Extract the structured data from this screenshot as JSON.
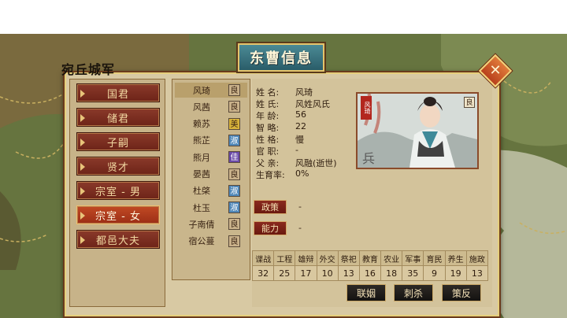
{
  "map_label": "宛丘城军",
  "window_title": "东曹信息",
  "close_icon": "✕",
  "nav": [
    {
      "label": "国君"
    },
    {
      "label": "储君"
    },
    {
      "label": "子嗣"
    },
    {
      "label": "贤才"
    },
    {
      "label": "宗室 - 男"
    },
    {
      "label": "宗室 - 女",
      "selected": true
    },
    {
      "label": "都邑大夫"
    }
  ],
  "people": [
    {
      "name": "风琦",
      "badge": "良",
      "type": "good"
    },
    {
      "name": "风茜",
      "badge": "良",
      "type": "good"
    },
    {
      "name": "赖苏",
      "badge": "美",
      "type": "beauty"
    },
    {
      "name": "熊芷",
      "badge": "淑",
      "type": "gentle"
    },
    {
      "name": "熊月",
      "badge": "佳",
      "type": "fine"
    },
    {
      "name": "晏茜",
      "badge": "良",
      "type": "good"
    },
    {
      "name": "杜棨",
      "badge": "淑",
      "type": "gentle"
    },
    {
      "name": "杜玉",
      "badge": "淑",
      "type": "gentle"
    },
    {
      "name": "子南倩",
      "badge": "良",
      "type": "good"
    },
    {
      "name": "宿公蔓",
      "badge": "良",
      "type": "good"
    }
  ],
  "info": [
    {
      "label": "姓  名:",
      "value": "风琦"
    },
    {
      "label": "姓  氏:",
      "value": "风姓风氏"
    },
    {
      "label": "年  龄:",
      "value": "56"
    },
    {
      "label": "智  略:",
      "value": "22"
    },
    {
      "label": "性  格:",
      "value": "慢"
    },
    {
      "label": "官  职:",
      "value": "-"
    },
    {
      "label": "父  亲:",
      "value": "风融(逝世)"
    },
    {
      "label": "生育率:",
      "value": "0%"
    }
  ],
  "portrait": {
    "tag": "风琦",
    "badge": "良"
  },
  "policy": {
    "label": "政策",
    "value": "-"
  },
  "ability": {
    "label": "能力",
    "value": "-"
  },
  "stats_headers": [
    "谍战",
    "工程",
    "雄辩",
    "外交",
    "祭祀",
    "教育",
    "农业",
    "军事",
    "育民",
    "养生",
    "施政"
  ],
  "stats_values": [
    "32",
    "25",
    "17",
    "10",
    "13",
    "16",
    "18",
    "35",
    "9",
    "19",
    "13"
  ],
  "actions": [
    "联姻",
    "刺杀",
    "策反"
  ]
}
